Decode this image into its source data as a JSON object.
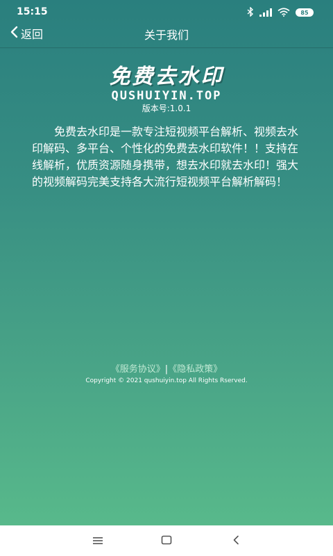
{
  "status_bar": {
    "time": "15:15",
    "battery": "85",
    "icons": [
      "bluetooth-icon",
      "cellular-signal-icon",
      "wifi-icon",
      "battery-icon"
    ]
  },
  "nav": {
    "back_label": "返回",
    "title": "关于我们"
  },
  "logo": {
    "cn": "免费去水印",
    "en": "QUSHUIYIN.TOP"
  },
  "version": "版本号:1.0.1",
  "intro": "免费去水印是一款专注短视频平台解析、视频去水印解码、多平台、个性化的免费去水印软件！！支持在线解析，优质资源随身携带，想去水印就去水印！强大的视频解码完美支持各大流行短视频平台解析解码！",
  "footer": {
    "service_link": "《服务协议》",
    "separator": "|",
    "privacy_link": "《隐私政策》",
    "copyright": "Copyright © 2021 qushuiyin.top All Rights Rserved."
  },
  "system_nav": {
    "icons": [
      "menu-icon",
      "home-icon",
      "back-icon"
    ]
  },
  "colors": {
    "gradient_top": "#2a7f7e",
    "gradient_bottom": "#58b98b",
    "link": "#bfe8d3",
    "text": "#ffffff"
  }
}
